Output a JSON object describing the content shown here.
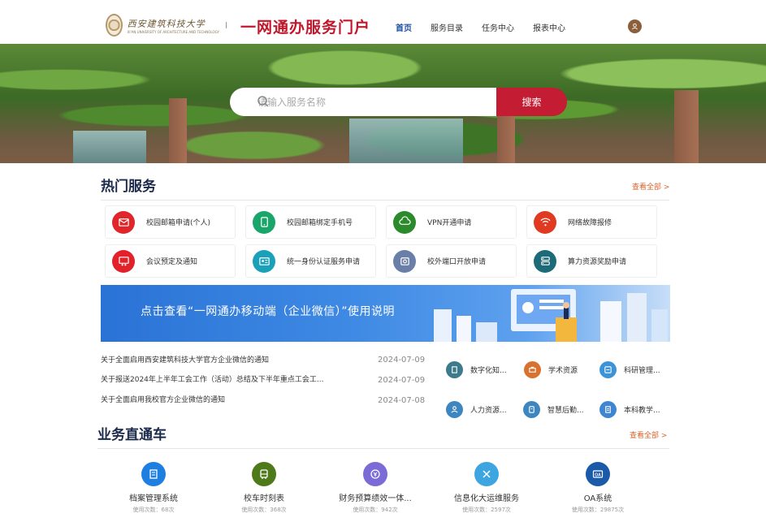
{
  "header": {
    "logo_cn": "西安建筑科技大学",
    "logo_en": "XI'AN UNIVERSITY OF ARCHITECTURE AND TECHNOLOGY",
    "portal_title": "一网通办服务门户",
    "nav": [
      "首页",
      "服务目录",
      "任务中心",
      "报表中心"
    ],
    "active_nav": "首页"
  },
  "search": {
    "placeholder": "请输入服务名称",
    "button": "搜索"
  },
  "hot_services": {
    "title": "热门服务",
    "view_all": "查看全部 >",
    "items": [
      {
        "label": "校园邮箱申请(个人)",
        "icon": "mail-icon",
        "color": "#e0262b"
      },
      {
        "label": "校园邮箱绑定手机号",
        "icon": "phone-icon",
        "color": "#1aa56b"
      },
      {
        "label": "VPN开通申请",
        "icon": "vpn-icon",
        "color": "#2b8a2b"
      },
      {
        "label": "网络故障报修",
        "icon": "wifi-icon",
        "color": "#e03a20"
      },
      {
        "label": "会议预定及通知",
        "icon": "meeting-icon",
        "color": "#e2222a"
      },
      {
        "label": "统一身份认证服务申请",
        "icon": "id-card-icon",
        "color": "#1aa0b8"
      },
      {
        "label": "校外端口开放申请",
        "icon": "port-icon",
        "color": "#6a7fa8"
      },
      {
        "label": "算力资源奖励申请",
        "icon": "server-icon",
        "color": "#1d6b79"
      }
    ]
  },
  "promo": {
    "text": "点击查看“一网通办移动端（企业微信）”使用说明"
  },
  "news": [
    {
      "title": "关于全面启用西安建筑科技大学官方企业微信的通知",
      "date": "2024-07-09"
    },
    {
      "title": "关于报送2024年上半年工会工作（活动）总结及下半年重点工会工...",
      "date": "2024-07-09"
    },
    {
      "title": "关于全面启用我校官方企业微信的通知",
      "date": "2024-07-08"
    }
  ],
  "categories": [
    {
      "label": "数字化知...",
      "icon": "book-icon",
      "color": "#3c7a8c"
    },
    {
      "label": "学术资源",
      "icon": "printer-icon",
      "color": "#d9722e"
    },
    {
      "label": "科研管理...",
      "icon": "research-icon",
      "color": "#3c93d8"
    },
    {
      "label": "人力资源...",
      "icon": "person-icon",
      "color": "#3e86c0"
    },
    {
      "label": "智慧后勤...",
      "icon": "logistics-icon",
      "color": "#3e86c0"
    },
    {
      "label": "本科教学...",
      "icon": "teaching-icon",
      "color": "#3f86d2"
    }
  ],
  "direct_services": {
    "title": "业务直通车",
    "view_all": "查看全部 >",
    "items": [
      {
        "name": "档案管理系统",
        "usage": "使用次数：68次",
        "icon": "archive-icon",
        "color": "#1f7fe0"
      },
      {
        "name": "校车时刻表",
        "usage": "使用次数：368次",
        "icon": "bus-icon",
        "color": "#4f7a1c"
      },
      {
        "name": "财务预算绩效一体...",
        "usage": "使用次数：942次",
        "icon": "finance-icon",
        "color": "#7a6bd6"
      },
      {
        "name": "信息化大运维服务",
        "usage": "使用次数：2597次",
        "icon": "tools-icon",
        "color": "#3da6e0"
      },
      {
        "name": "OA系统",
        "usage": "使用次数：29875次",
        "icon": "oa-icon",
        "color": "#1a5aa8"
      }
    ]
  }
}
